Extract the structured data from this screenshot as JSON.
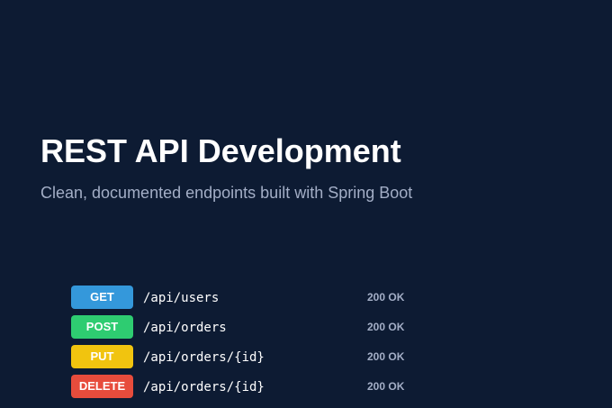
{
  "header": {
    "title": "REST API Development",
    "subtitle": "Clean, documented endpoints built with Spring Boot"
  },
  "endpoints": [
    {
      "method": "GET",
      "path": "/api/users",
      "status": "200 OK",
      "color": "#3498db"
    },
    {
      "method": "POST",
      "path": "/api/orders",
      "status": "200 OK",
      "color": "#2ecc71"
    },
    {
      "method": "PUT",
      "path": "/api/orders/{id}",
      "status": "200 OK",
      "color": "#f1c40f"
    },
    {
      "method": "DELETE",
      "path": "/api/orders/{id}",
      "status": "200 OK",
      "color": "#e74c3c"
    }
  ],
  "colors": {
    "background": "#0d1b33",
    "title": "#ffffff",
    "subtitle": "#a3aec6",
    "status": "#a3aec6"
  }
}
